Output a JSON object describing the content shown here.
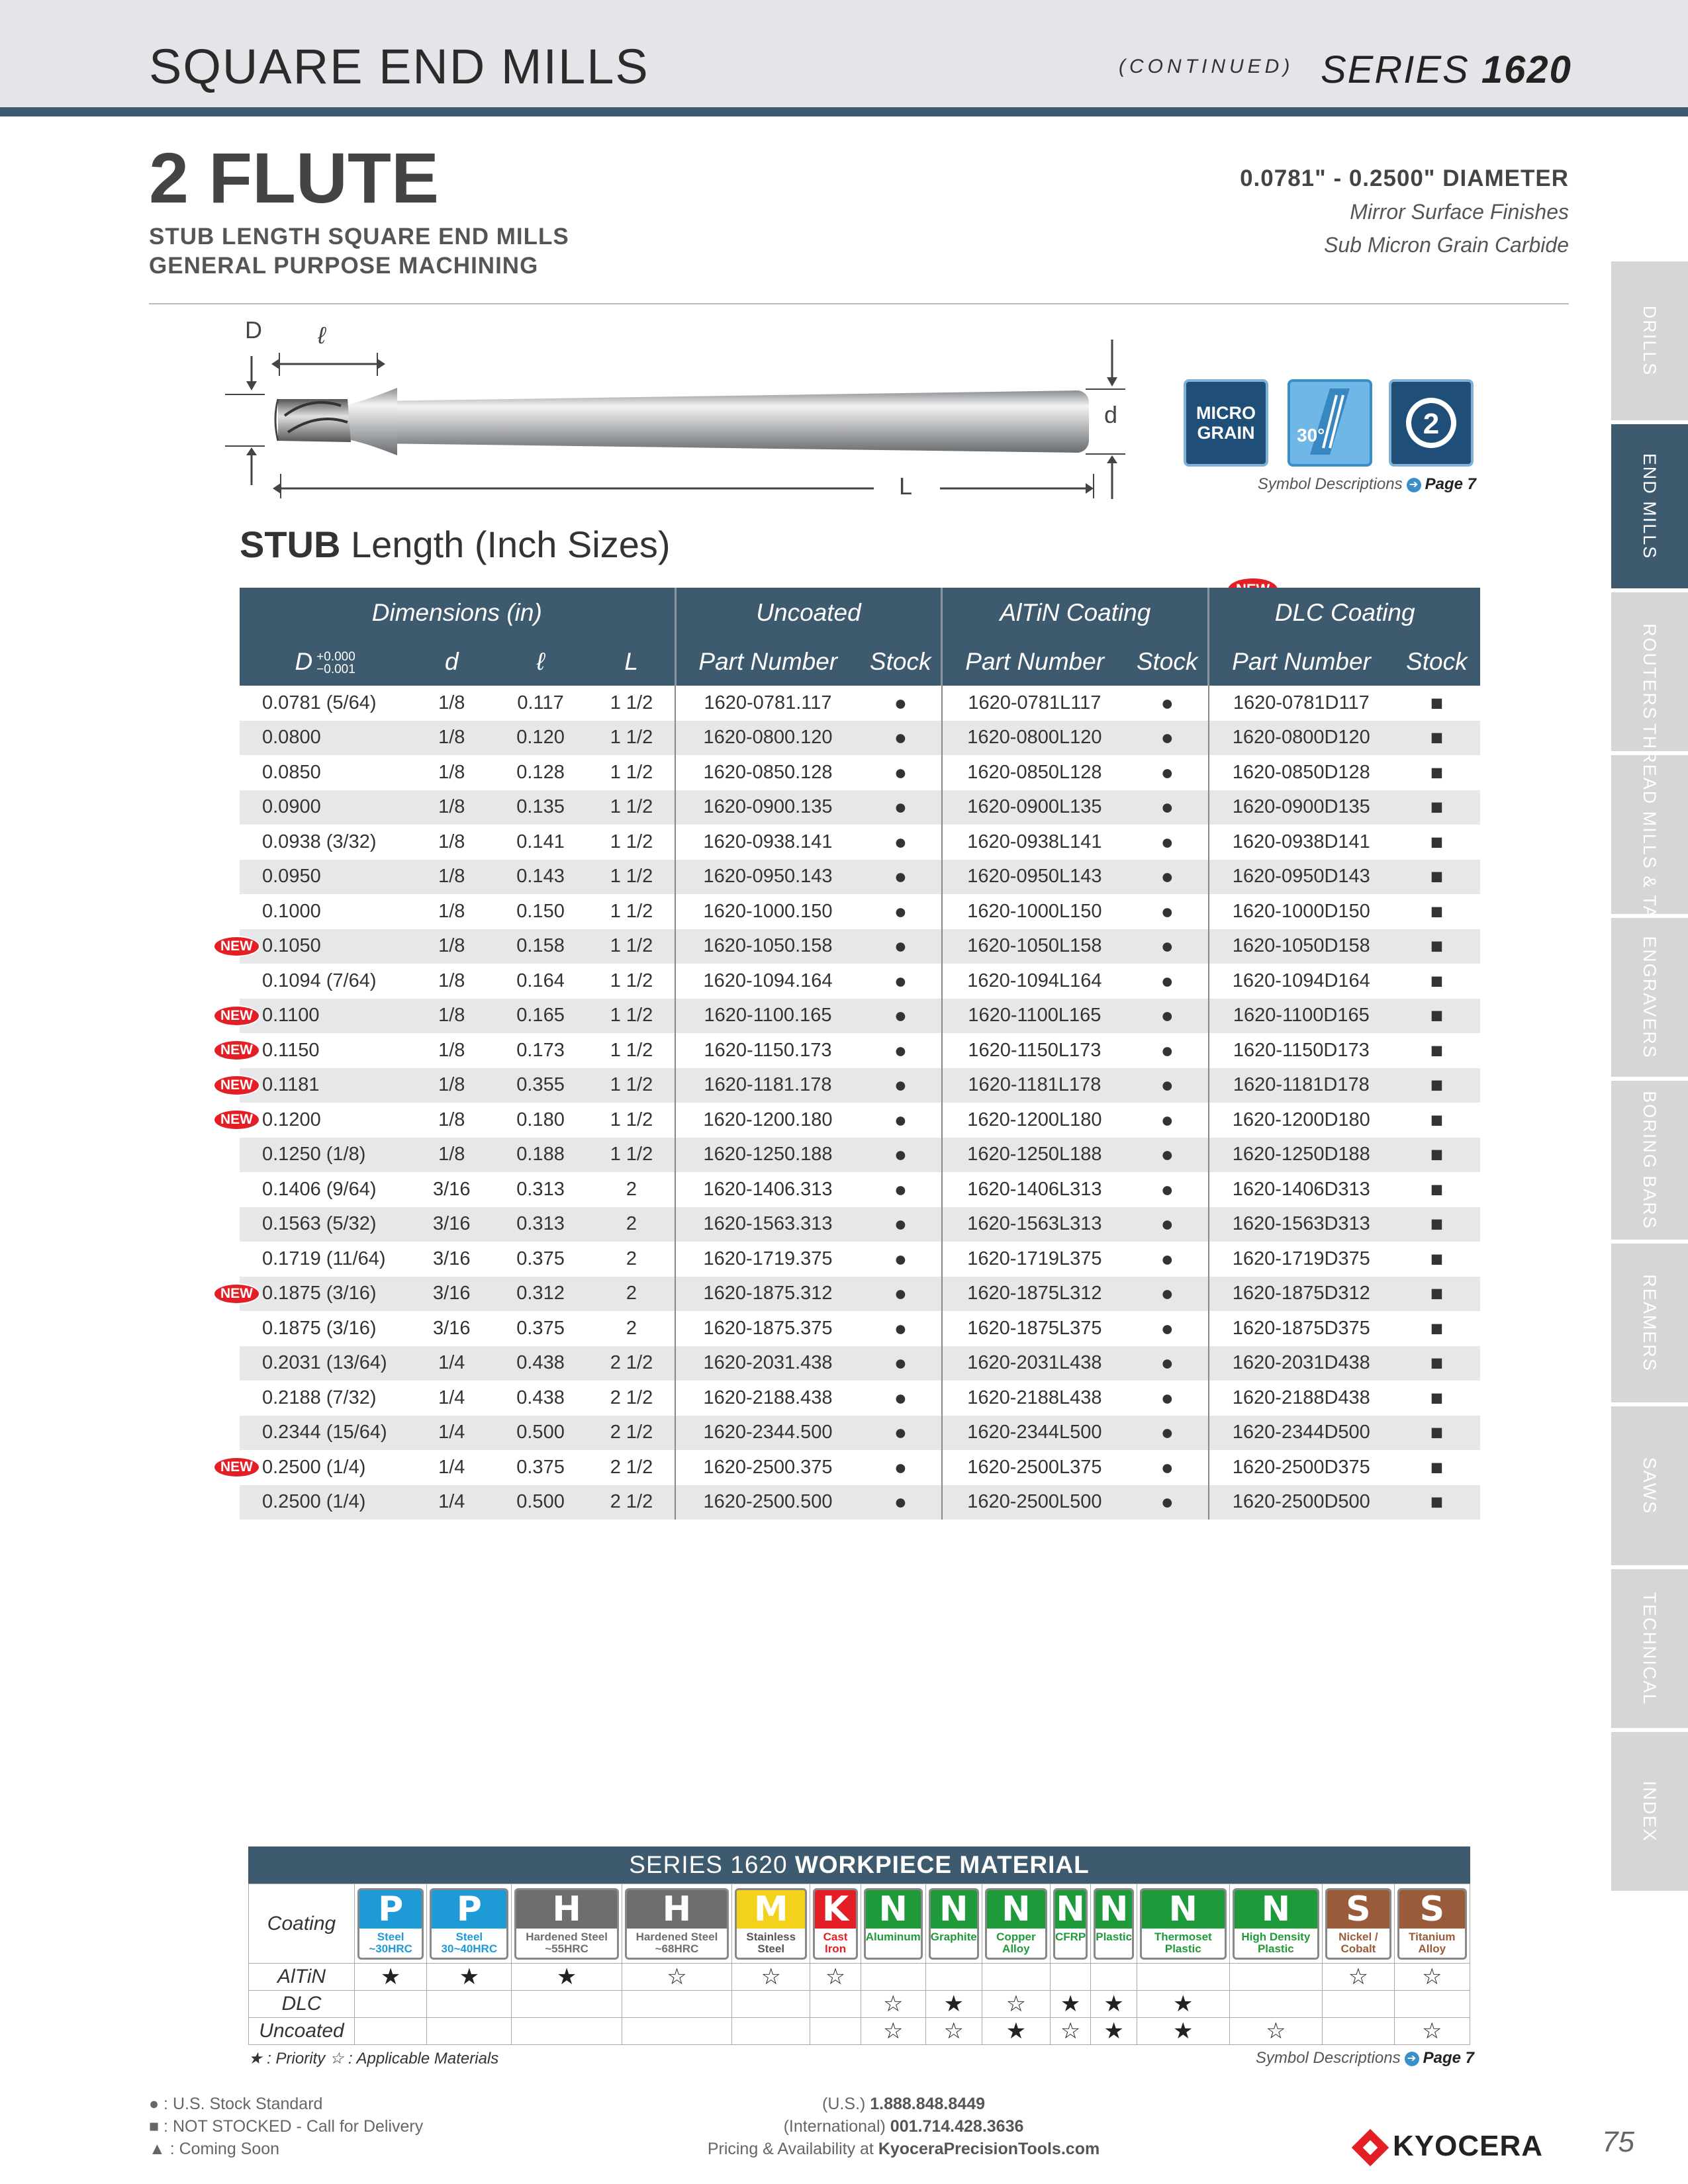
{
  "header": {
    "title": "SQUARE END MILLS",
    "continued": "(CONTINUED)",
    "series_label": "SERIES",
    "series_number": "1620"
  },
  "side_tabs": [
    "DRILLS",
    "END MILLS",
    "ROUTERS",
    "THREAD MILLS & TAPS",
    "ENGRAVERS",
    "BORING BARS",
    "REAMERS",
    "SAWS",
    "TECHNICAL",
    "INDEX"
  ],
  "active_tab": "END MILLS",
  "product": {
    "title": "2 FLUTE",
    "subtitle_1": "STUB LENGTH SQUARE END MILLS",
    "subtitle_2": "GENERAL PURPOSE MACHINING",
    "diameter": "0.0781\" - 0.2500\" DIAMETER",
    "feature_1": "Mirror Surface Finishes",
    "feature_2": "Sub Micron Grain Carbide"
  },
  "drawing": {
    "label_D": "D",
    "label_l": "ℓ",
    "label_d": "d",
    "label_L": "L"
  },
  "icons": {
    "micro_1": "MICRO",
    "micro_2": "GRAIN",
    "helix": "30°",
    "flutes": "2"
  },
  "symbol_desc": {
    "text": "Symbol Descriptions",
    "page": "Page 7"
  },
  "section": {
    "bold": "STUB",
    "rest": " Length (Inch Sizes)"
  },
  "table": {
    "group_headers": [
      "Dimensions (in)",
      "Uncoated",
      "AlTiN Coating",
      "DLC Coating"
    ],
    "new_label": "NEW",
    "tolerance": {
      "plus": "+0.000",
      "minus": "−0.001"
    },
    "col_headers": [
      "D",
      "d",
      "ℓ",
      "L",
      "Part Number",
      "Stock",
      "Part Number",
      "Stock",
      "Part Number",
      "Stock"
    ],
    "stock_symbols": {
      "uncoated": "●",
      "altin": "●",
      "dlc": "■"
    },
    "rows": [
      {
        "D": "0.0781 (5/64)",
        "d": "1/8",
        "l": "0.117",
        "L": "1 1/2",
        "unc": "1620-0781.117",
        "alt": "1620-0781L117",
        "dlc": "1620-0781D117",
        "new": false
      },
      {
        "D": "0.0800",
        "d": "1/8",
        "l": "0.120",
        "L": "1 1/2",
        "unc": "1620-0800.120",
        "alt": "1620-0800L120",
        "dlc": "1620-0800D120",
        "new": false
      },
      {
        "D": "0.0850",
        "d": "1/8",
        "l": "0.128",
        "L": "1 1/2",
        "unc": "1620-0850.128",
        "alt": "1620-0850L128",
        "dlc": "1620-0850D128",
        "new": false
      },
      {
        "D": "0.0900",
        "d": "1/8",
        "l": "0.135",
        "L": "1 1/2",
        "unc": "1620-0900.135",
        "alt": "1620-0900L135",
        "dlc": "1620-0900D135",
        "new": false
      },
      {
        "D": "0.0938 (3/32)",
        "d": "1/8",
        "l": "0.141",
        "L": "1 1/2",
        "unc": "1620-0938.141",
        "alt": "1620-0938L141",
        "dlc": "1620-0938D141",
        "new": false
      },
      {
        "D": "0.0950",
        "d": "1/8",
        "l": "0.143",
        "L": "1 1/2",
        "unc": "1620-0950.143",
        "alt": "1620-0950L143",
        "dlc": "1620-0950D143",
        "new": false
      },
      {
        "D": "0.1000",
        "d": "1/8",
        "l": "0.150",
        "L": "1 1/2",
        "unc": "1620-1000.150",
        "alt": "1620-1000L150",
        "dlc": "1620-1000D150",
        "new": false
      },
      {
        "D": "0.1050",
        "d": "1/8",
        "l": "0.158",
        "L": "1 1/2",
        "unc": "1620-1050.158",
        "alt": "1620-1050L158",
        "dlc": "1620-1050D158",
        "new": true
      },
      {
        "D": "0.1094 (7/64)",
        "d": "1/8",
        "l": "0.164",
        "L": "1 1/2",
        "unc": "1620-1094.164",
        "alt": "1620-1094L164",
        "dlc": "1620-1094D164",
        "new": false
      },
      {
        "D": "0.1100",
        "d": "1/8",
        "l": "0.165",
        "L": "1 1/2",
        "unc": "1620-1100.165",
        "alt": "1620-1100L165",
        "dlc": "1620-1100D165",
        "new": true
      },
      {
        "D": "0.1150",
        "d": "1/8",
        "l": "0.173",
        "L": "1 1/2",
        "unc": "1620-1150.173",
        "alt": "1620-1150L173",
        "dlc": "1620-1150D173",
        "new": true
      },
      {
        "D": "0.1181",
        "d": "1/8",
        "l": "0.355",
        "L": "1 1/2",
        "unc": "1620-1181.178",
        "alt": "1620-1181L178",
        "dlc": "1620-1181D178",
        "new": true
      },
      {
        "D": "0.1200",
        "d": "1/8",
        "l": "0.180",
        "L": "1 1/2",
        "unc": "1620-1200.180",
        "alt": "1620-1200L180",
        "dlc": "1620-1200D180",
        "new": true
      },
      {
        "D": "0.1250 (1/8)",
        "d": "1/8",
        "l": "0.188",
        "L": "1 1/2",
        "unc": "1620-1250.188",
        "alt": "1620-1250L188",
        "dlc": "1620-1250D188",
        "new": false
      },
      {
        "D": "0.1406 (9/64)",
        "d": "3/16",
        "l": "0.313",
        "L": "2",
        "unc": "1620-1406.313",
        "alt": "1620-1406L313",
        "dlc": "1620-1406D313",
        "new": false
      },
      {
        "D": "0.1563 (5/32)",
        "d": "3/16",
        "l": "0.313",
        "L": "2",
        "unc": "1620-1563.313",
        "alt": "1620-1563L313",
        "dlc": "1620-1563D313",
        "new": false
      },
      {
        "D": "0.1719 (11/64)",
        "d": "3/16",
        "l": "0.375",
        "L": "2",
        "unc": "1620-1719.375",
        "alt": "1620-1719L375",
        "dlc": "1620-1719D375",
        "new": false
      },
      {
        "D": "0.1875 (3/16)",
        "d": "3/16",
        "l": "0.312",
        "L": "2",
        "unc": "1620-1875.312",
        "alt": "1620-1875L312",
        "dlc": "1620-1875D312",
        "new": true
      },
      {
        "D": "0.1875 (3/16)",
        "d": "3/16",
        "l": "0.375",
        "L": "2",
        "unc": "1620-1875.375",
        "alt": "1620-1875L375",
        "dlc": "1620-1875D375",
        "new": false
      },
      {
        "D": "0.2031 (13/64)",
        "d": "1/4",
        "l": "0.438",
        "L": "2 1/2",
        "unc": "1620-2031.438",
        "alt": "1620-2031L438",
        "dlc": "1620-2031D438",
        "new": false
      },
      {
        "D": "0.2188 (7/32)",
        "d": "1/4",
        "l": "0.438",
        "L": "2 1/2",
        "unc": "1620-2188.438",
        "alt": "1620-2188L438",
        "dlc": "1620-2188D438",
        "new": false
      },
      {
        "D": "0.2344 (15/64)",
        "d": "1/4",
        "l": "0.500",
        "L": "2 1/2",
        "unc": "1620-2344.500",
        "alt": "1620-2344L500",
        "dlc": "1620-2344D500",
        "new": false
      },
      {
        "D": "0.2500 (1/4)",
        "d": "1/4",
        "l": "0.375",
        "L": "2 1/2",
        "unc": "1620-2500.375",
        "alt": "1620-2500L375",
        "dlc": "1620-2500D375",
        "new": true
      },
      {
        "D": "0.2500 (1/4)",
        "d": "1/4",
        "l": "0.500",
        "L": "2 1/2",
        "unc": "1620-2500.500",
        "alt": "1620-2500L500",
        "dlc": "1620-2500D500",
        "new": false
      }
    ]
  },
  "workpiece": {
    "title_regular": "SERIES 1620 ",
    "title_bold": "WORKPIECE MATERIAL",
    "coating_label": "Coating",
    "materials": [
      {
        "letter": "P",
        "sub": "Steel ~30HRC",
        "color": "#1e9ad6"
      },
      {
        "letter": "P",
        "sub": "Steel 30~40HRC",
        "color": "#1e9ad6"
      },
      {
        "letter": "H",
        "sub": "Hardened Steel ~55HRC",
        "color": "#6d6e70"
      },
      {
        "letter": "H",
        "sub": "Hardened Steel ~68HRC",
        "color": "#6d6e70"
      },
      {
        "letter": "M",
        "sub": "Stainless Steel",
        "color": "#f2d21a"
      },
      {
        "letter": "K",
        "sub": "Cast Iron",
        "color": "#e31e24"
      },
      {
        "letter": "N",
        "sub": "Aluminum",
        "color": "#1f9a3a"
      },
      {
        "letter": "N",
        "sub": "Graphite",
        "color": "#1f9a3a"
      },
      {
        "letter": "N",
        "sub": "Copper Alloy",
        "color": "#1f9a3a"
      },
      {
        "letter": "N",
        "sub": "CFRP",
        "color": "#1f9a3a"
      },
      {
        "letter": "N",
        "sub": "Plastic",
        "color": "#1f9a3a"
      },
      {
        "letter": "N",
        "sub": "Thermoset Plastic",
        "color": "#1f9a3a"
      },
      {
        "letter": "N",
        "sub": "High Density Plastic",
        "color": "#1f9a3a"
      },
      {
        "letter": "S",
        "sub": "Nickel / Cobalt",
        "color": "#9a5b3a"
      },
      {
        "letter": "S",
        "sub": "Titanium Alloy",
        "color": "#9a5b3a"
      }
    ],
    "rows": [
      {
        "label": "AlTiN",
        "marks": [
          "★",
          "★",
          "★",
          "☆",
          "☆",
          "☆",
          "",
          "",
          "",
          "",
          "",
          "",
          "",
          "☆",
          "☆"
        ]
      },
      {
        "label": "DLC",
        "marks": [
          "",
          "",
          "",
          "",
          "",
          "",
          "☆",
          "★",
          "☆",
          "★",
          "★",
          "★",
          "",
          "",
          ""
        ]
      },
      {
        "label": "Uncoated",
        "marks": [
          "",
          "",
          "",
          "",
          "",
          "",
          "☆",
          "☆",
          "★",
          "☆",
          "★",
          "★",
          "☆",
          "",
          "☆"
        ]
      }
    ],
    "legend": "★ : Priority  ☆ : Applicable Materials"
  },
  "footer": {
    "left": [
      "● : U.S. Stock Standard",
      "■ : NOT STOCKED - Call for Delivery",
      "▲ : Coming Soon"
    ],
    "phone_us_label": "(U.S.) ",
    "phone_us": "1.888.848.8449",
    "phone_intl_label": "(International) ",
    "phone_intl": "001.714.428.3636",
    "pricing_label": "Pricing & Availability at ",
    "pricing_site": "KyoceraPrecisionTools.com",
    "brand": "KYOCERA",
    "page_number": "75"
  },
  "colors": {
    "header_bar": "#3e5a6e",
    "new_badge": "#e31e24",
    "row_alt": "#e6e7e8"
  }
}
